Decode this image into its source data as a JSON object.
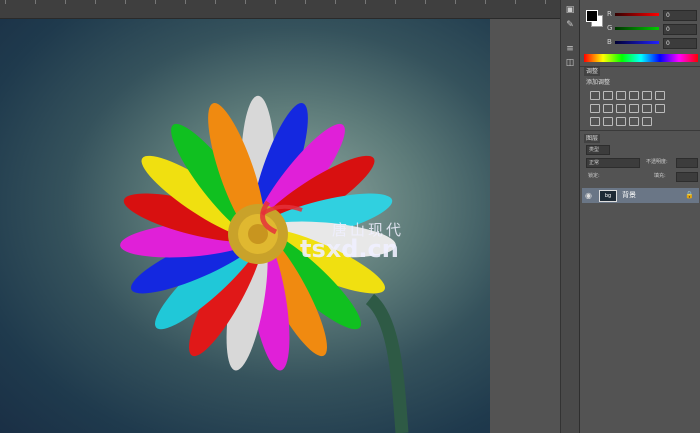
{
  "watermark": {
    "chinese": "唐山现代",
    "domain": "tsxd.cn"
  },
  "colors": {
    "app_bg": "#535353",
    "ruler": "#3f3f3f",
    "selected_layer": "#6a7686"
  },
  "toolstrip": {
    "icons": [
      "history-icon",
      "brush-preset-icon",
      "layers-panel-icon",
      "channels-icon"
    ]
  },
  "color_panel": {
    "sliders": [
      {
        "label": "R",
        "value": "0"
      },
      {
        "label": "G",
        "value": "0"
      },
      {
        "label": "B",
        "value": "0"
      }
    ]
  },
  "adjustments_panel": {
    "tab_label": "调整",
    "title": "添加调整"
  },
  "layers_panel": {
    "tab_label": "图层",
    "filter_label": "类型",
    "mode_label": "正常",
    "opacity_label": "不透明度:",
    "lock_label": "锁定:",
    "fill_label": "填充:",
    "layer": {
      "name": "背景",
      "thumb_label": "bg"
    }
  }
}
